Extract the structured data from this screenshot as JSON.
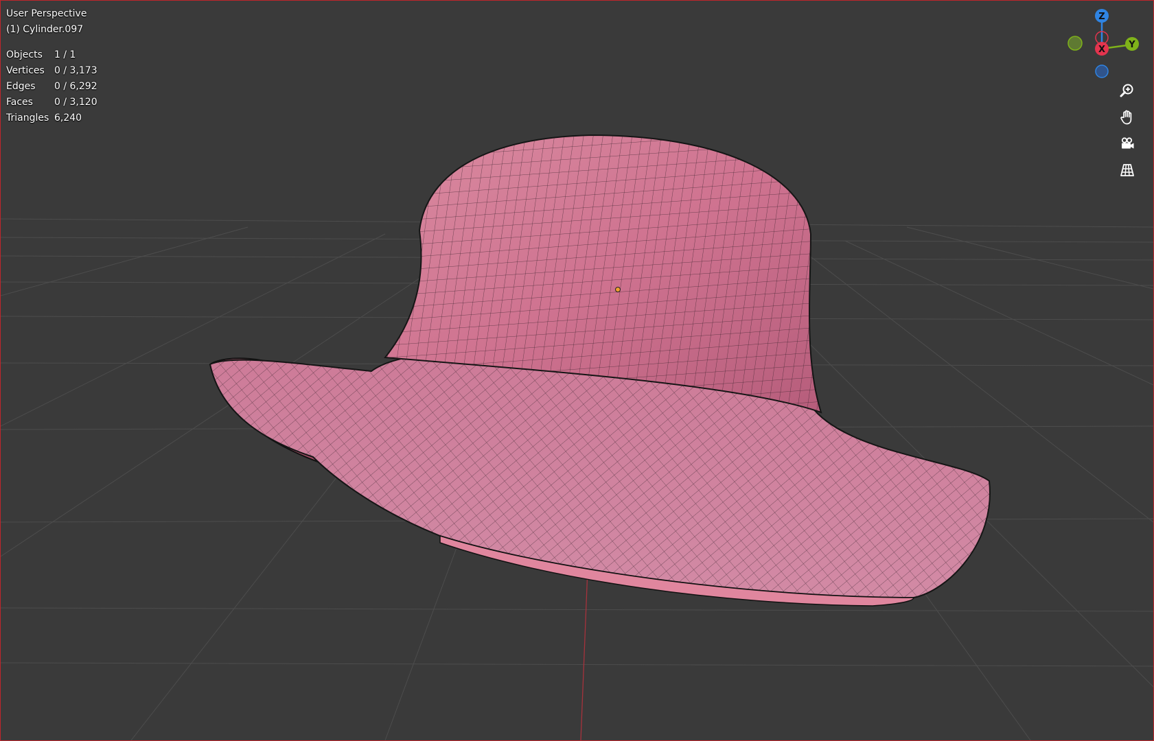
{
  "header": {
    "view_name": "User Perspective",
    "object_name": "(1) Cylinder.097"
  },
  "stats": [
    {
      "label": "Objects",
      "value": "1 / 1"
    },
    {
      "label": "Vertices",
      "value": "0 / 3,173"
    },
    {
      "label": "Edges",
      "value": "0 / 6,292"
    },
    {
      "label": "Faces",
      "value": "0 / 3,120"
    },
    {
      "label": "Triangles",
      "value": "6,240"
    }
  ],
  "gizmo": {
    "z_label": "Z",
    "y_label": "Y",
    "x_label": "X",
    "colors": {
      "x": "#e3344e",
      "y": "#7fb21a",
      "z": "#2f84e3",
      "neg_y": "#5f7a32",
      "neg_z": "#30548b"
    }
  },
  "nav_buttons": [
    {
      "name": "zoom-button",
      "icon": "zoom-icon"
    },
    {
      "name": "pan-button",
      "icon": "hand-icon"
    },
    {
      "name": "camera-button",
      "icon": "camera-icon"
    },
    {
      "name": "perspective-toggle-button",
      "icon": "grid-perspective-icon"
    }
  ],
  "colors": {
    "background": "#3a3a3a",
    "grid": "#555555",
    "mesh_fill": "#cf7896",
    "mesh_wire": "#1a1a1a",
    "border": "#c0262b"
  }
}
